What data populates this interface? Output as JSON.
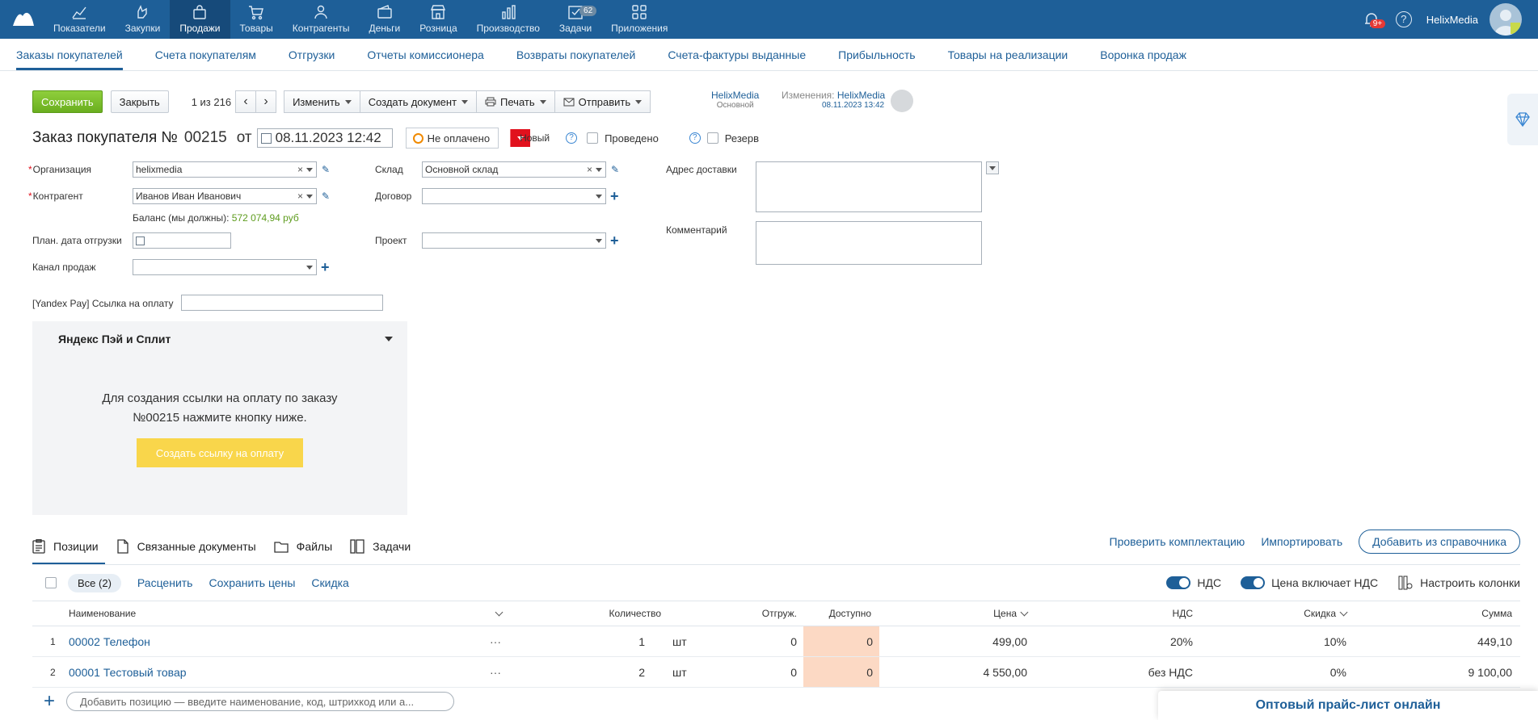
{
  "topnav": {
    "items": [
      {
        "label": "Показатели",
        "icon": "chart-line-icon"
      },
      {
        "label": "Закупки",
        "icon": "hand-icon"
      },
      {
        "label": "Продажи",
        "icon": "bag-icon"
      },
      {
        "label": "Товары",
        "icon": "cart-icon"
      },
      {
        "label": "Контрагенты",
        "icon": "people-icon"
      },
      {
        "label": "Деньги",
        "icon": "wallet-icon"
      },
      {
        "label": "Розница",
        "icon": "store-icon"
      },
      {
        "label": "Производство",
        "icon": "bars-icon"
      },
      {
        "label": "Задачи",
        "icon": "check-icon",
        "badge": "62"
      },
      {
        "label": "Приложения",
        "icon": "apps-icon"
      }
    ],
    "notifications_badge": "9+",
    "help": "?",
    "company": "HelixMedia"
  },
  "subnav": {
    "items": [
      "Заказы покупателей",
      "Счета покупателям",
      "Отгрузки",
      "Отчеты комиссионера",
      "Возвраты покупателей",
      "Счета-фактуры выданные",
      "Прибыльность",
      "Товары на реализации",
      "Воронка продаж"
    ]
  },
  "toolbar": {
    "save": "Сохранить",
    "close": "Закрыть",
    "pager": "1 из 216",
    "prev": "‹",
    "next": "›",
    "change": "Изменить",
    "create_doc": "Создать документ",
    "print": "Печать",
    "send": "Отправить"
  },
  "owner": {
    "name": "HelixMedia",
    "sub": "Основной"
  },
  "changes": {
    "label": "Изменения:",
    "who": "HelixMedia",
    "when": "08.11.2023 13:42"
  },
  "doc": {
    "title": "Заказ покупателя №",
    "number": "00215",
    "from": "от",
    "date": "08.11.2023 12:42",
    "paid_status": "Не оплачено",
    "state": "Новый",
    "posted": "Проведено",
    "reserve": "Резерв",
    "q": "?"
  },
  "form": {
    "organization_label": "Организация",
    "organization_value": "helixmedia",
    "counterparty_label": "Контрагент",
    "counterparty_value": "Иванов Иван Иванович",
    "balance_label": "Баланс (мы должны):",
    "balance_value": "572 074,94 руб",
    "ship_date_label": "План. дата отгрузки",
    "sales_channel_label": "Канал продаж",
    "warehouse_label": "Склад",
    "warehouse_value": "Основной склад",
    "contract_label": "Договор",
    "project_label": "Проект",
    "delivery_address_label": "Адрес доставки",
    "comment_label": "Комментарий",
    "yandex_link_label": "[Yandex Pay] Ссылка на оплату"
  },
  "yandex": {
    "title": "Яндекс Пэй и Сплит",
    "message_line1": "Для создания ссылки на оплату по заказу",
    "message_line2": "№00215 нажмите кнопку ниже.",
    "button": "Создать ссылку на оплату"
  },
  "tabs": [
    {
      "label": "Позиции",
      "icon": "clipboard-icon"
    },
    {
      "label": "Связанные документы",
      "icon": "document-icon"
    },
    {
      "label": "Файлы",
      "icon": "folder-icon"
    },
    {
      "label": "Задачи",
      "icon": "tasks-icon"
    }
  ],
  "tab_actions": {
    "check": "Проверить комплектацию",
    "import": "Импортировать",
    "add_from_ref": "Добавить из справочника"
  },
  "table_toolbar": {
    "all": "Все (2)",
    "reprice": "Расценить",
    "save_prices": "Сохранить цены",
    "discount": "Скидка",
    "vat": "НДС",
    "price_incl_vat": "Цена включает НДС",
    "configure_columns": "Настроить колонки"
  },
  "table": {
    "headers": {
      "name": "Наименование",
      "qty": "Количество",
      "shipped": "Отгруж.",
      "available": "Доступно",
      "price": "Цена",
      "vat": "НДС",
      "discount": "Скидка",
      "sum": "Сумма"
    },
    "rows": [
      {
        "n": "1",
        "name": "00002 Телефон",
        "more": "···",
        "qty": "1",
        "unit": "шт",
        "shipped": "0",
        "available": "0",
        "price": "499,00",
        "vat": "20%",
        "discount": "10%",
        "sum": "449,10"
      },
      {
        "n": "2",
        "name": "00001 Тестовый товар",
        "more": "···",
        "qty": "2",
        "unit": "шт",
        "shipped": "0",
        "available": "0",
        "price": "4 550,00",
        "vat": "без НДС",
        "discount": "0%",
        "sum": "9 100,00"
      }
    ]
  },
  "add_position": {
    "placeholder": "Добавить позицию — введите наименование, код, штрихкод или а..."
  },
  "banner": {
    "text": "Оптовый прайс-лист онлайн"
  }
}
